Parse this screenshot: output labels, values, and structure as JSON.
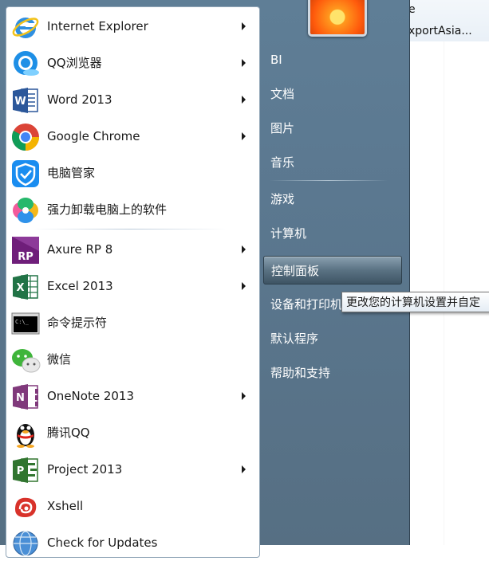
{
  "background_window": {
    "rows": [
      "e",
      "xportAsia..."
    ]
  },
  "programs": [
    {
      "label": "Internet Explorer",
      "icon": "internet-explorer-icon",
      "has_arrow": true
    },
    {
      "label": "QQ浏览器",
      "icon": "qq-browser-icon",
      "has_arrow": true
    },
    {
      "label": "Word 2013",
      "icon": "word-icon",
      "has_arrow": true
    },
    {
      "label": "Google Chrome",
      "icon": "chrome-icon",
      "has_arrow": true
    },
    {
      "label": "电脑管家",
      "icon": "pc-manager-icon",
      "has_arrow": false
    },
    {
      "label": "强力卸载电脑上的软件",
      "icon": "uninstaller-icon",
      "has_arrow": false
    },
    {
      "label": "Axure RP 8",
      "icon": "axure-icon",
      "has_arrow": true
    },
    {
      "label": "Excel 2013",
      "icon": "excel-icon",
      "has_arrow": true
    },
    {
      "label": "命令提示符",
      "icon": "cmd-icon",
      "has_arrow": false
    },
    {
      "label": "微信",
      "icon": "wechat-icon",
      "has_arrow": false
    },
    {
      "label": "OneNote 2013",
      "icon": "onenote-icon",
      "has_arrow": true
    },
    {
      "label": "腾讯QQ",
      "icon": "qq-penguin-icon",
      "has_arrow": false
    },
    {
      "label": "Project 2013",
      "icon": "project-icon",
      "has_arrow": true
    },
    {
      "label": "Xshell",
      "icon": "xshell-icon",
      "has_arrow": false
    },
    {
      "label": "Check for Updates",
      "icon": "globe-update-icon",
      "has_arrow": false
    }
  ],
  "right_pane": {
    "items": [
      {
        "label": "BI"
      },
      {
        "label": "文档"
      },
      {
        "label": "图片"
      },
      {
        "label": "音乐"
      },
      {
        "label": "游戏"
      },
      {
        "label": "计算机"
      },
      {
        "label": "控制面板",
        "highlighted": true
      },
      {
        "label": "设备和打印机"
      },
      {
        "label": "默认程序"
      },
      {
        "label": "帮助和支持"
      }
    ]
  },
  "tooltip": {
    "text": "更改您的计算机设置并自定"
  },
  "colors": {
    "menu_bg": "#5b7890",
    "highlight": "#4a6274",
    "tooltip_border": "#767676"
  }
}
